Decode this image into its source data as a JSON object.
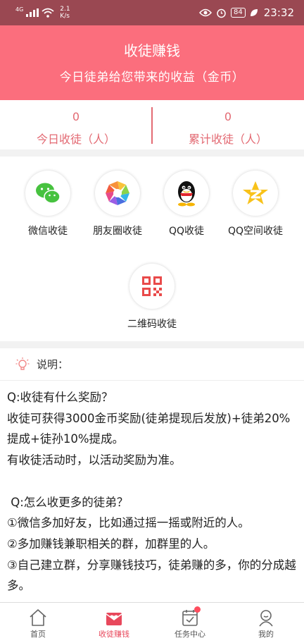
{
  "status_bar": {
    "signal_label": "4G",
    "speed": "2.1",
    "speed_unit": "K/s",
    "battery": "84",
    "time": "23:32"
  },
  "header": {
    "title": "收徒赚钱",
    "subtitle": "今日徒弟给您带来的收益（金币）"
  },
  "stats": [
    {
      "value": "0",
      "label": "今日收徒（人）"
    },
    {
      "value": "0",
      "label": "累计收徒（人）"
    }
  ],
  "share_options": [
    {
      "label": "微信收徒",
      "icon": "wechat-icon"
    },
    {
      "label": "朋友圈收徒",
      "icon": "moments-icon"
    },
    {
      "label": "QQ收徒",
      "icon": "qq-icon"
    },
    {
      "label": "QQ空间收徒",
      "icon": "qzone-icon"
    },
    {
      "label": "二维码收徒",
      "icon": "qrcode-icon"
    }
  ],
  "explain": {
    "title": "说明：",
    "lines": [
      "Q:收徒有什么奖励？",
      "收徒可获得3000金币奖励(徒弟提现后发放)+徒弟20%提成+徒孙10%提成。",
      "有收徒活动时，以活动奖励为准。",
      "",
      " Q:怎么收更多的徒弟？",
      "①微信多加好友，比如通过摇一摇或附近的人。",
      "②多加赚钱兼职相关的群，加群里的人。",
      "③自己建立群，分享赚钱技巧，徒弟赚的多，你的分成越多。"
    ]
  },
  "tabs": [
    {
      "label": "首页",
      "icon": "home-icon"
    },
    {
      "label": "收徒赚钱",
      "icon": "heart-envelope-icon"
    },
    {
      "label": "任务中心",
      "icon": "task-icon"
    },
    {
      "label": "我的",
      "icon": "profile-icon"
    }
  ],
  "colors": {
    "accent": "#fb6e7d",
    "status_bar": "#9a4852",
    "stat_text": "#e36a73",
    "active_tab": "#e8485c"
  }
}
